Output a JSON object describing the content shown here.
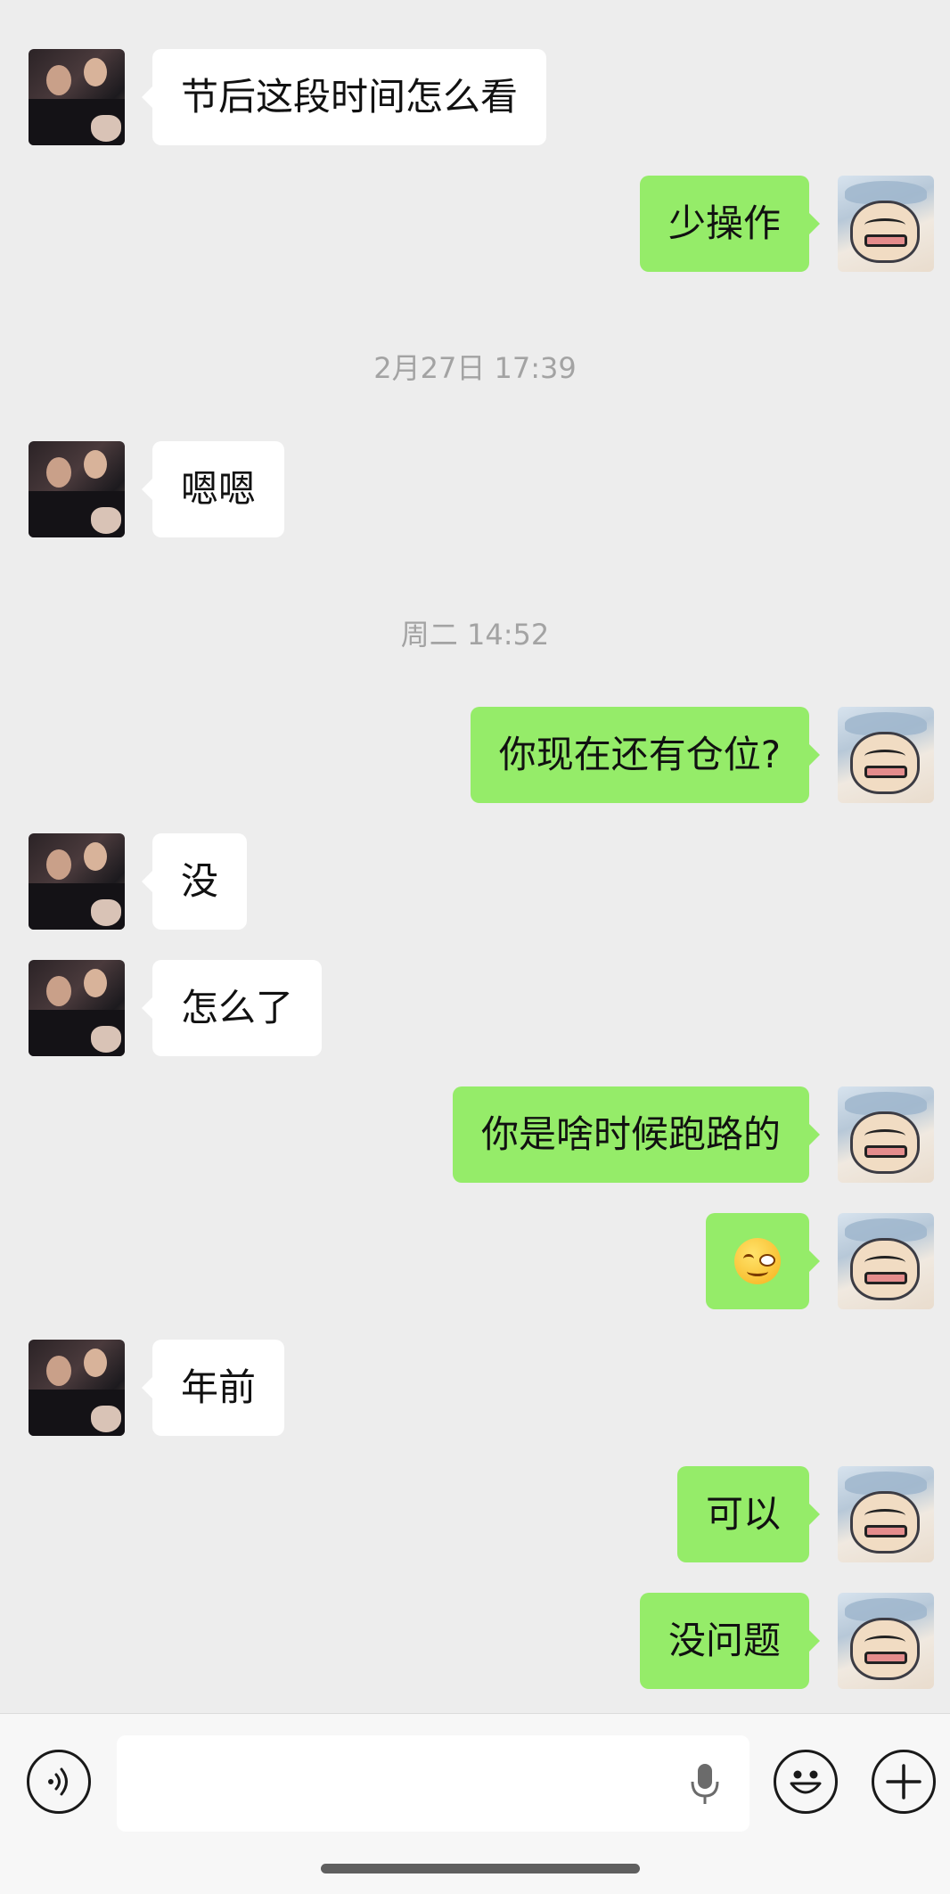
{
  "messages": [
    {
      "side": "left",
      "text": "节后这段时间怎么看"
    },
    {
      "side": "right",
      "text": "少操作"
    },
    {
      "side": "left",
      "text": "嗯嗯"
    },
    {
      "side": "right",
      "text": "你现在还有仓位?"
    },
    {
      "side": "left",
      "text": "没"
    },
    {
      "side": "left",
      "text": "怎么了"
    },
    {
      "side": "right",
      "text": "你是啥时候跑路的"
    },
    {
      "side": "right",
      "emoji": "smirk-face-emoji"
    },
    {
      "side": "left",
      "text": "年前"
    },
    {
      "side": "right",
      "text": "可以"
    },
    {
      "side": "right",
      "text": "没问题"
    }
  ],
  "timestamps": [
    "2月27日 17:39",
    "周二 14:52"
  ],
  "input": {
    "value": "",
    "placeholder": ""
  },
  "toolbar": {
    "voice_icon": "voice-icon",
    "mic_icon": "microphone-icon",
    "emoji_icon": "emoji-icon",
    "plus_icon": "plus-icon"
  },
  "colors": {
    "background": "#ededed",
    "sent_bubble": "#95ec69",
    "received_bubble": "#ffffff",
    "timestamp_text": "#a3a3a3"
  }
}
